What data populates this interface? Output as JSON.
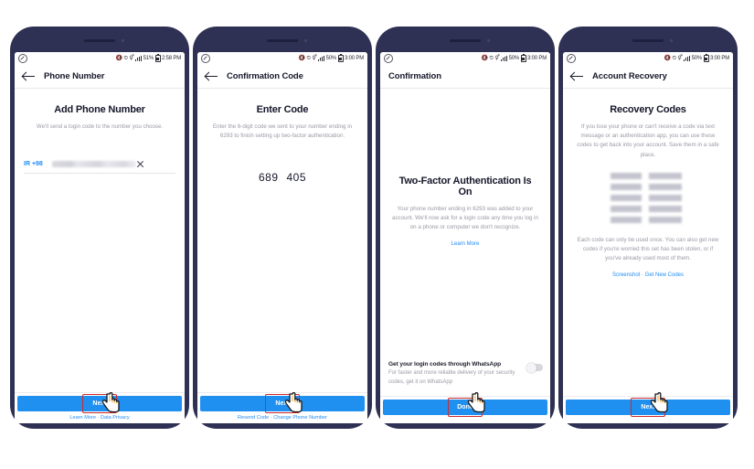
{
  "meta": {
    "background_color": "#ffffff",
    "frame_color": "#2f3154",
    "accent_blue": "#1f90f0",
    "link_blue": "#1f8bf5",
    "highlight_red": "#cc2b2b",
    "muted_text": "#9a9aa6"
  },
  "phones": [
    {
      "id": "phone-1",
      "status_bar": {
        "left_icon": "whatsapp-muted-icon",
        "mute_icon": "mute-icon",
        "alarm_icon": "alarm-icon",
        "bluetooth_icon": "bluetooth-icon",
        "signal_icon": "signal-icon",
        "battery_percent": "51%",
        "battery_icon": "battery-icon",
        "time": "2:58 PM"
      },
      "appbar": {
        "back": "back-arrow-icon",
        "title": "Phone Number",
        "has_back": true
      },
      "headline": "Add Phone Number",
      "subtext": "We'll send a login code to the number you choose.",
      "phone_input": {
        "country_code": "IR +98",
        "value": "",
        "value_masked": true,
        "clear_icon": "close-x-icon"
      },
      "cta": {
        "label": "Next",
        "highlighted": true
      },
      "footer_links": "Learn More · Data Privacy",
      "cursor": {
        "visible": true
      }
    },
    {
      "id": "phone-2",
      "status_bar": {
        "left_icon": "whatsapp-muted-icon",
        "mute_icon": "mute-icon",
        "alarm_icon": "alarm-icon",
        "bluetooth_icon": "bluetooth-icon",
        "signal_icon": "signal-icon",
        "battery_percent": "50%",
        "battery_icon": "battery-icon",
        "time": "3:00 PM"
      },
      "appbar": {
        "back": "back-arrow-icon",
        "title": "Confirmation Code",
        "has_back": true
      },
      "headline": "Enter Code",
      "subtext": "Enter the 6-digit code we sent to your number ending in 6293 to finish setting up two-factor authentication.",
      "code": {
        "group_one": "689",
        "group_two": "405"
      },
      "cta": {
        "label": "Next",
        "highlighted": true
      },
      "footer_links": "Resend Code · Change Phone Number",
      "cursor": {
        "visible": true
      }
    },
    {
      "id": "phone-3",
      "status_bar": {
        "left_icon": "whatsapp-muted-icon",
        "mute_icon": "mute-icon",
        "alarm_icon": "alarm-icon",
        "bluetooth_icon": "bluetooth-icon",
        "signal_icon": "signal-icon",
        "battery_percent": "50%",
        "battery_icon": "battery-icon",
        "time": "3:00 PM"
      },
      "appbar": {
        "back": "",
        "title": "Confirmation",
        "has_back": false
      },
      "headline": "Two-Factor Authentication Is On",
      "subtext": "Your phone number ending in 6293 was added to your account. We'll now ask for a login code any time you log in on a phone or computer we don't recognize.",
      "learn_more": "Learn More",
      "whatsapp_row": {
        "title": "Get your login codes through WhatsApp",
        "subtitle": "For faster and more reliable delivery of your security codes, get it on WhatsApp",
        "toggle_on": false
      },
      "cta": {
        "label": "Done",
        "highlighted": true
      },
      "footer_links": "",
      "cursor": {
        "visible": true
      }
    },
    {
      "id": "phone-4",
      "status_bar": {
        "left_icon": "whatsapp-muted-icon",
        "mute_icon": "mute-icon",
        "alarm_icon": "alarm-icon",
        "bluetooth_icon": "bluetooth-icon",
        "signal_icon": "signal-icon",
        "battery_percent": "50%",
        "battery_icon": "battery-icon",
        "time": "3:00 PM"
      },
      "appbar": {
        "back": "back-arrow-icon",
        "title": "Account Recovery",
        "has_back": true
      },
      "headline": "Recovery Codes",
      "subtext": "If you lose your phone or can't receive a code via text message or an authentication app, you can use these codes to get back into your account. Save them in a safe place.",
      "recovery_codes_masked": true,
      "recovery_codes_count": 5,
      "footnote": "Each code can only be used once. You can also get new codes if you're worried this set has been stolen, or if you've already used most of them.",
      "action_link": "Screenshot · Get New Codes",
      "cta": {
        "label": "Next",
        "highlighted": true
      },
      "footer_links": "",
      "cursor": {
        "visible": true
      }
    }
  ]
}
